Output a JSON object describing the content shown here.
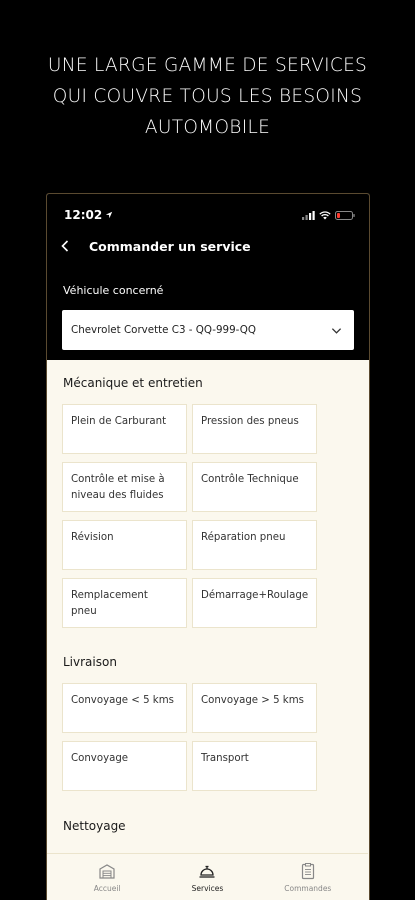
{
  "promo": {
    "line1": "UNE LARGE GAMME DE SERVICES",
    "line2": "QUI COUVRE TOUS LES BESOINS",
    "line3": "AUTOMOBILE"
  },
  "status_bar": {
    "time": "12:02"
  },
  "header": {
    "title": "Commander un service"
  },
  "vehicle": {
    "label": "Véhicule concerné",
    "selected": "Chevrolet Corvette C3 - QQ-999-QQ"
  },
  "sections": [
    {
      "title": "Mécanique et entretien",
      "items": [
        "Plein de Carburant",
        "Pression des pneus",
        "Contrôle et mise à niveau des fluides",
        "Contrôle Technique",
        "Révision",
        "Réparation pneu",
        "Remplacement pneu",
        "Démarrage+Roulage"
      ]
    },
    {
      "title": "Livraison",
      "items": [
        "Convoyage < 5 kms",
        "Convoyage > 5 kms",
        "Convoyage",
        "Transport"
      ]
    },
    {
      "title": "Nettoyage",
      "items": []
    }
  ],
  "tabbar": {
    "tabs": [
      {
        "label": "Accueil",
        "icon": "garage-icon",
        "active": false
      },
      {
        "label": "Services",
        "icon": "service-bell-icon",
        "active": true
      },
      {
        "label": "Commandes",
        "icon": "clipboard-icon",
        "active": false
      }
    ]
  }
}
